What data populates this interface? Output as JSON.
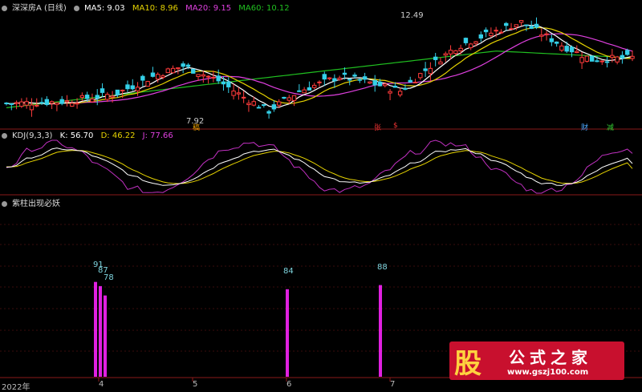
{
  "header_main": {
    "title": "深深房A (日线)",
    "ma5": "MA5: 9.03",
    "ma10": "MA10: 8.96",
    "ma20": "MA20: 9.15",
    "ma60": "MA60: 10.12",
    "colors": {
      "ma5": "#ffffff",
      "ma10": "#e6d300",
      "ma20": "#e040e0",
      "ma60": "#20c020"
    }
  },
  "header_kdj": {
    "title": "KDJ(9,3,3)",
    "k": "K: 56.70",
    "d": "D: 46.22",
    "j": "J: 77.66",
    "colors": {
      "k": "#ffffff",
      "d": "#e6d300",
      "j": "#e040e0"
    }
  },
  "header_ind": {
    "title": "紫柱出现必妖"
  },
  "annotations": {
    "high": "12.49",
    "low": "7.92",
    "tags": [
      "稿",
      "张",
      "$",
      "财",
      "减"
    ]
  },
  "x_axis": [
    "2022年",
    "4",
    "5",
    "6",
    "7"
  ],
  "watermark": {
    "stamp": "股",
    "name": "公式之家",
    "url": "www.gszj100.com"
  },
  "chart_data": [
    {
      "type": "candlestick",
      "title": "深深房A (日线)",
      "series": [
        {
          "name": "MA5",
          "value": 9.03
        },
        {
          "name": "MA10",
          "value": 8.96
        },
        {
          "name": "MA20",
          "value": 9.15
        },
        {
          "name": "MA60",
          "value": 10.12
        }
      ],
      "annotations": [
        {
          "label": "12.49",
          "kind": "high"
        },
        {
          "label": "7.92",
          "kind": "low"
        }
      ]
    },
    {
      "type": "line",
      "title": "KDJ(9,3,3)",
      "series": [
        {
          "name": "K",
          "last": 56.7
        },
        {
          "name": "D",
          "last": 46.22
        },
        {
          "name": "J",
          "last": 77.66
        }
      ]
    },
    {
      "type": "bar",
      "title": "紫柱出现必妖",
      "categories": [
        "91",
        "87",
        "78",
        "84",
        "88"
      ],
      "values": [
        91,
        87,
        78,
        84,
        88
      ]
    }
  ]
}
